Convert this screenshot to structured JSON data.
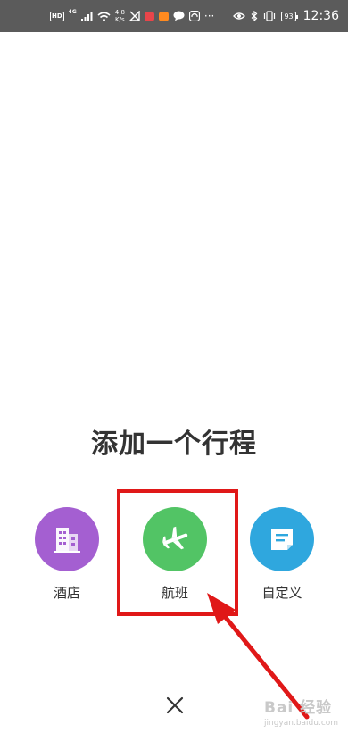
{
  "status_bar": {
    "hd": "HD",
    "network": "4G",
    "speed_value": "4.8",
    "speed_unit": "K/s",
    "more": "···",
    "battery": "93",
    "time": "12:36"
  },
  "dialog": {
    "title": "添加一个行程",
    "options": [
      {
        "label": "酒店",
        "icon": "building-icon",
        "color": "#a45fd1"
      },
      {
        "label": "航班",
        "icon": "airplane-icon",
        "color": "#52c465"
      },
      {
        "label": "自定义",
        "icon": "note-icon",
        "color": "#2fa7de"
      }
    ],
    "close_icon": "close-icon"
  },
  "annotation": {
    "highlight_color": "#e01818"
  },
  "watermark": {
    "brand": "Bai 经验",
    "url": "jingyan.baidu.com"
  }
}
